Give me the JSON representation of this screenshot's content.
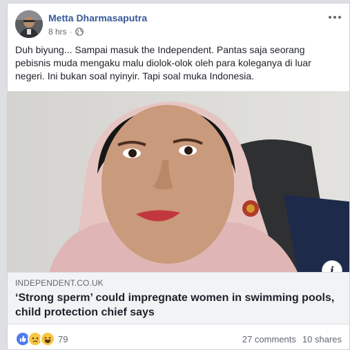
{
  "post": {
    "author": "Metta Dharmasaputra",
    "time": "8 hrs",
    "separator": "·",
    "privacy_icon": "globe-icon",
    "text": "Duh biyung... Sampai masuk the Independent. Pantas saja seorang pebisnis muda mengaku malu diolok-olok oleh para koleganya di luar negeri. Ini bukan soal nyinyir. Tapi soal muka Indonesia."
  },
  "link": {
    "domain": "INDEPENDENT.CO.UK",
    "title": "‘Strong sperm’ could impregnate women in swimming pools, child protection chief says",
    "info_label": "i"
  },
  "footer": {
    "reaction_icons": [
      "like-icon",
      "sad-icon",
      "haha-icon"
    ],
    "reaction_count": "79",
    "comments": "27 comments",
    "shares": "10 shares"
  },
  "colors": {
    "author_link": "#365899",
    "like_blue": "#4f7bf0",
    "sad_yellow": "#f7c744",
    "background": "#dddfe2"
  }
}
